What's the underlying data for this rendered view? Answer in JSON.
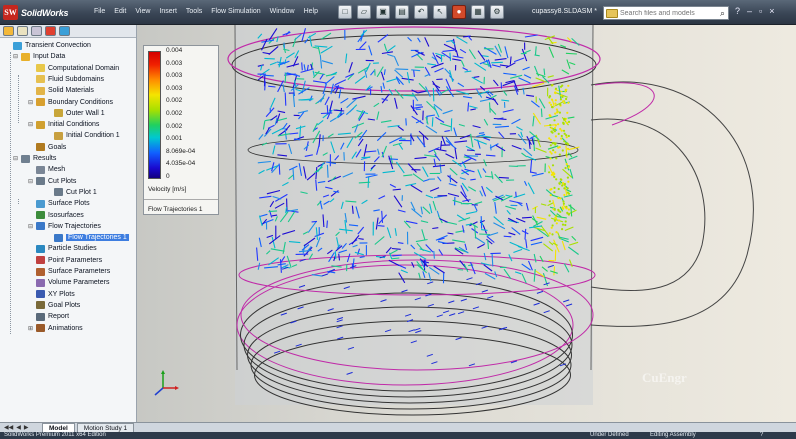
{
  "app": {
    "logo_mark": "SW",
    "logo_word": "SolidWorks",
    "menus": [
      "File",
      "Edit",
      "View",
      "Insert",
      "Tools",
      "Flow Simulation",
      "Window",
      "Help"
    ],
    "document_title": "cupassy8.SLDASM *",
    "search_placeholder": "Search files and models",
    "quick_access_icons": [
      "new-icon",
      "open-icon",
      "save-icon",
      "print-icon",
      "undo-icon",
      "select-icon",
      "rebuild-icon",
      "file-properties-icon",
      "options-icon"
    ]
  },
  "tree": {
    "items": [
      {
        "label": "Transient Convection",
        "level": 0,
        "icon": "flow-project-icon"
      },
      {
        "label": "Input Data",
        "level": 1,
        "icon": "input-data-icon",
        "expander": "-"
      },
      {
        "label": "Computational Domain",
        "level": 2,
        "icon": "domain-icon"
      },
      {
        "label": "Fluid Subdomains",
        "level": 2,
        "icon": "fluid-icon"
      },
      {
        "label": "Solid Materials",
        "level": 2,
        "icon": "solid-icon"
      },
      {
        "label": "Boundary Conditions",
        "level": 2,
        "icon": "boundary-icon",
        "expander": "-"
      },
      {
        "label": "Outer Wall 1",
        "level": 3,
        "icon": "wall-icon"
      },
      {
        "label": "Initial Conditions",
        "level": 2,
        "icon": "initial-icon",
        "expander": "-"
      },
      {
        "label": "Initial Condition 1",
        "level": 3,
        "icon": "condition-icon"
      },
      {
        "label": "Goals",
        "level": 2,
        "icon": "goals-icon"
      },
      {
        "label": "Results",
        "level": 1,
        "icon": "results-icon",
        "expander": "-"
      },
      {
        "label": "Mesh",
        "level": 2,
        "icon": "mesh-icon"
      },
      {
        "label": "Cut Plots",
        "level": 2,
        "icon": "cut-plot-icon",
        "expander": "-"
      },
      {
        "label": "Cut Plot 1",
        "level": 3,
        "icon": "cut-plot-icon"
      },
      {
        "label": "Surface Plots",
        "level": 2,
        "icon": "surface-plot-icon"
      },
      {
        "label": "Isosurfaces",
        "level": 2,
        "icon": "isosurface-icon"
      },
      {
        "label": "Flow Trajectories",
        "level": 2,
        "icon": "trajectory-icon",
        "expander": "-"
      },
      {
        "label": "Flow Trajectories 1",
        "level": 3,
        "icon": "trajectory-icon",
        "selected": true
      },
      {
        "label": "Particle Studies",
        "level": 2,
        "icon": "particle-icon"
      },
      {
        "label": "Point Parameters",
        "level": 2,
        "icon": "point-param-icon"
      },
      {
        "label": "Surface Parameters",
        "level": 2,
        "icon": "surface-param-icon"
      },
      {
        "label": "Volume Parameters",
        "level": 2,
        "icon": "volume-param-icon"
      },
      {
        "label": "XY Plots",
        "level": 2,
        "icon": "xy-plot-icon"
      },
      {
        "label": "Goal Plots",
        "level": 2,
        "icon": "goal-plot-icon"
      },
      {
        "label": "Report",
        "level": 2,
        "icon": "report-icon"
      },
      {
        "label": "Animations",
        "level": 2,
        "icon": "animation-icon",
        "expander": "+"
      }
    ]
  },
  "legend": {
    "ticks": [
      "0.004",
      "0.003",
      "0.003",
      "0.003",
      "0.002",
      "0.002",
      "0.002",
      "0.001",
      "8.069e-04",
      "4.035e-04",
      "0"
    ],
    "units": "Velocity [m/s]",
    "caption": "Flow Trajectories 1",
    "colors": [
      "#d40000",
      "#ff8c00",
      "#f5e400",
      "#20d060",
      "#00c8d0",
      "#1060ff",
      "#140080"
    ]
  },
  "viewport": {
    "watermark": "CuEngr"
  },
  "bottom": {
    "tabs": [
      {
        "label": "Model",
        "active": true
      },
      {
        "label": "Motion Study 1",
        "active": false
      }
    ],
    "status_left": "SolidWorks Premium 2011 x64 Edition",
    "status_1": "Under Defined",
    "status_2": "Editing Assembly",
    "status_3": "?"
  }
}
